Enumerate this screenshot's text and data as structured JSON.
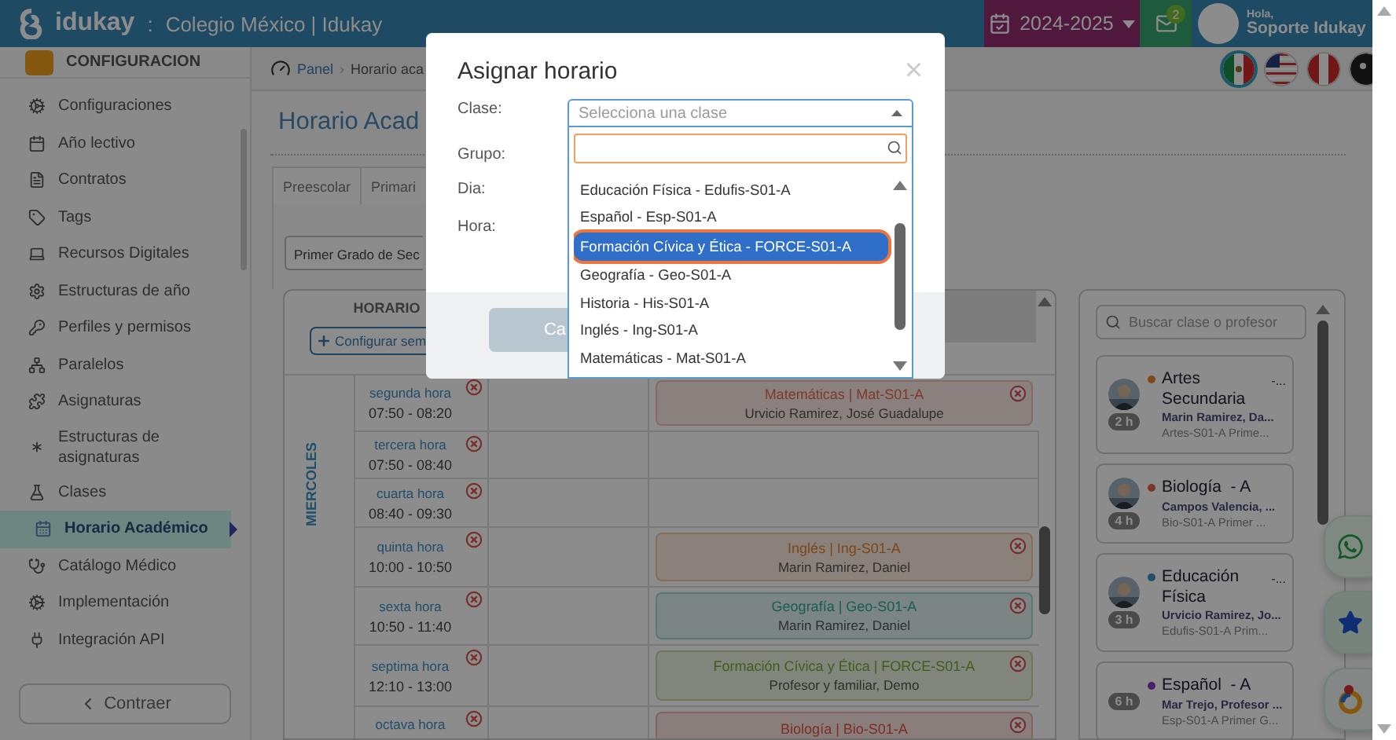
{
  "topbar": {
    "brand": "idukay",
    "separator": ":",
    "school": "Colegio México | Idukay",
    "year": "2024-2025",
    "mail_count": "2",
    "greeting": "Hola,",
    "user": "Soporte Idukay"
  },
  "sidebar": {
    "header": "CONFIGURACION",
    "items": [
      {
        "label": "Configuraciones",
        "selected": false
      },
      {
        "label": "Año lectivo",
        "selected": false
      },
      {
        "label": "Contratos",
        "selected": false
      },
      {
        "label": "Tags",
        "selected": false
      },
      {
        "label": "Recursos Digitales",
        "selected": false
      },
      {
        "label": "Estructuras de año",
        "selected": false
      },
      {
        "label": "Perfiles y permisos",
        "selected": false
      },
      {
        "label": "Paralelos",
        "selected": false
      },
      {
        "label": "Asignaturas",
        "selected": false
      },
      {
        "label": "Estructuras de asignaturas",
        "selected": false
      },
      {
        "label": "Clases",
        "selected": false
      },
      {
        "label": "Horario Académico",
        "selected": true
      },
      {
        "label": "Catálogo Médico",
        "selected": false
      },
      {
        "label": "Implementación",
        "selected": false
      },
      {
        "label": "Integración API",
        "selected": false
      }
    ],
    "collapse": "Contraer"
  },
  "breadcrumb": {
    "items": [
      "Panel",
      "Horario aca"
    ],
    "separator": "›"
  },
  "flags": [
    {
      "kind": "mexico",
      "selected": true
    },
    {
      "kind": "usa",
      "selected": false
    },
    {
      "kind": "peru",
      "selected": false
    },
    {
      "kind": "dark",
      "selected": false
    }
  ],
  "page_title": "Horario Acad",
  "level_tabs": [
    "Preescolar",
    "Primari"
  ],
  "grade_select": "Primer Grado de Sec",
  "schedule": {
    "header": "HORARIO",
    "configure": "Configurar sem",
    "day": "MIERCOLES",
    "rows": [
      {
        "period": "segunda hora",
        "time": "07:50 - 08:20",
        "entry": {
          "subject": "Matemáticas | Mat-S01-A",
          "teacher": "Urvicio Ramirez, José Guadalupe",
          "color": "#8a807e"
        }
      },
      {
        "period": "tercera hora",
        "time": "07:50 - 08:40"
      },
      {
        "period": "cuarta hora",
        "time": "08:40 - 09:30"
      },
      {
        "period": "quinta hora",
        "time": "10:00 - 10:50",
        "entry": {
          "subject": "Inglés | Ing-S01-A",
          "teacher": "Marin Ramirez, Daniel",
          "color": "#8a827b"
        }
      },
      {
        "period": "sexta hora",
        "time": "10:50 - 11:40",
        "entry": {
          "subject": "Geografía | Geo-S01-A",
          "teacher": "Marin Ramirez, Daniel",
          "color": "#7b8584"
        }
      },
      {
        "period": "septima hora",
        "time": "12:10 - 13:00",
        "entry": {
          "subject": "Formación Cívica y Ética | FORCE-S01-A",
          "teacher": "Profesor y familiar, Demo",
          "color": "#81857c"
        }
      },
      {
        "period": "octava hora",
        "entry": {
          "subject": "Biología | Bio-S01-A",
          "color": "#8a7e7d"
        }
      }
    ]
  },
  "class_panel": {
    "search_placeholder": "Buscar clase o profesor",
    "cards": [
      {
        "title": "Artes Secundaria",
        "suffix": "-...",
        "teacher": "Marin Ramirez, Da...",
        "code": "Artes-S01-A Prime...",
        "hours": "2 h",
        "color": "#804817"
      },
      {
        "title": "Biología  - A",
        "teacher": "Campos Valencia, ...",
        "code": "Bio-S01-A Primer ...",
        "hours": "4 h",
        "color": "#7b382b"
      },
      {
        "title": "Educación Física",
        "suffix": "-...",
        "teacher": "Urvicio Ramirez, Jo...",
        "code": "Edufis-S01-A Prim...",
        "hours": "3 h",
        "color": "#204f6c"
      },
      {
        "kind": "plain",
        "title": "Español  - A",
        "teacher": "Mar Trejo, Profesor ...",
        "code": "Esp-S01-A Primer G...",
        "hours": "6 h",
        "color": "#43236c"
      }
    ]
  },
  "modal": {
    "title": "Asignar horario",
    "close": "×",
    "fields": [
      "Clase:",
      "Grupo:",
      "Dia:",
      "Hora:"
    ],
    "select_placeholder": "Selecciona una clase",
    "cancel": "Ca",
    "options": [
      {
        "label": "Educación Física - Edufis-S01-A",
        "selected": false
      },
      {
        "label": "Español - Esp-S01-A",
        "selected": false
      },
      {
        "label": "Formación Cívica y Ética - FORCE-S01-A",
        "selected": true
      },
      {
        "label": "Geografía - Geo-S01-A",
        "selected": false
      },
      {
        "label": "Historia - His-S01-A",
        "selected": false
      },
      {
        "label": "Inglés - Ing-S01-A",
        "selected": false
      },
      {
        "label": "Matemáticas - Mat-S01-A",
        "selected": false
      }
    ]
  }
}
